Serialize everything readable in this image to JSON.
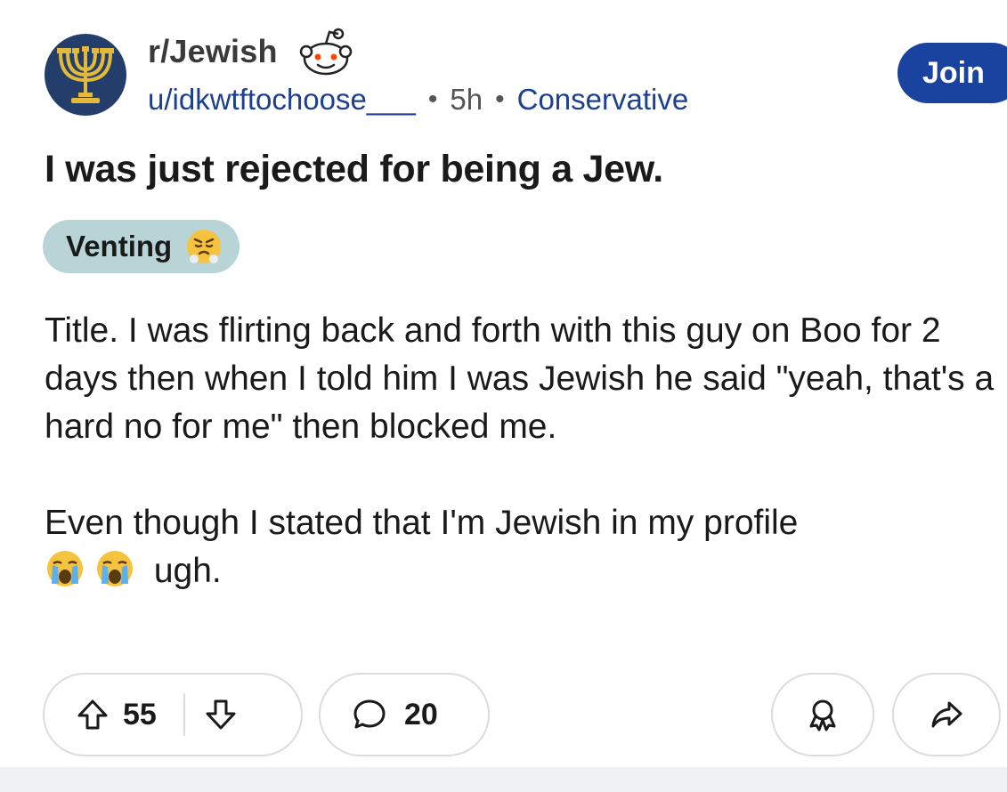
{
  "post": {
    "subreddit": "r/Jewish",
    "author": "u/idkwtftochoose___",
    "time": "5h",
    "user_flair": "Conservative",
    "join_label": "Join",
    "title": "I was just rejected for being a Jew.",
    "flair_label": "Venting",
    "body_p1": "Title. I was flirting back and forth with this guy on Boo for 2 days then when I told him I was Jewish he said \"yeah, that's a hard no for me\" then blocked me.",
    "body_p2_text": "Even though I stated that I'm Jewish in my profile",
    "body_p2_end": "ugh.",
    "upvotes": "55",
    "comments": "20"
  },
  "colors": {
    "join_bg": "#1a43a0",
    "link": "#1c3f8f",
    "flair_bg": "#b8d4d7",
    "avatar_bg": "#233e6b",
    "menorah": "#e2b93b"
  },
  "icons": [
    "menorah-icon",
    "snoo-icon",
    "steaming-face-emoji",
    "loudly-crying-face-emoji",
    "upvote-icon",
    "downvote-icon",
    "comment-icon",
    "award-icon",
    "share-icon"
  ]
}
